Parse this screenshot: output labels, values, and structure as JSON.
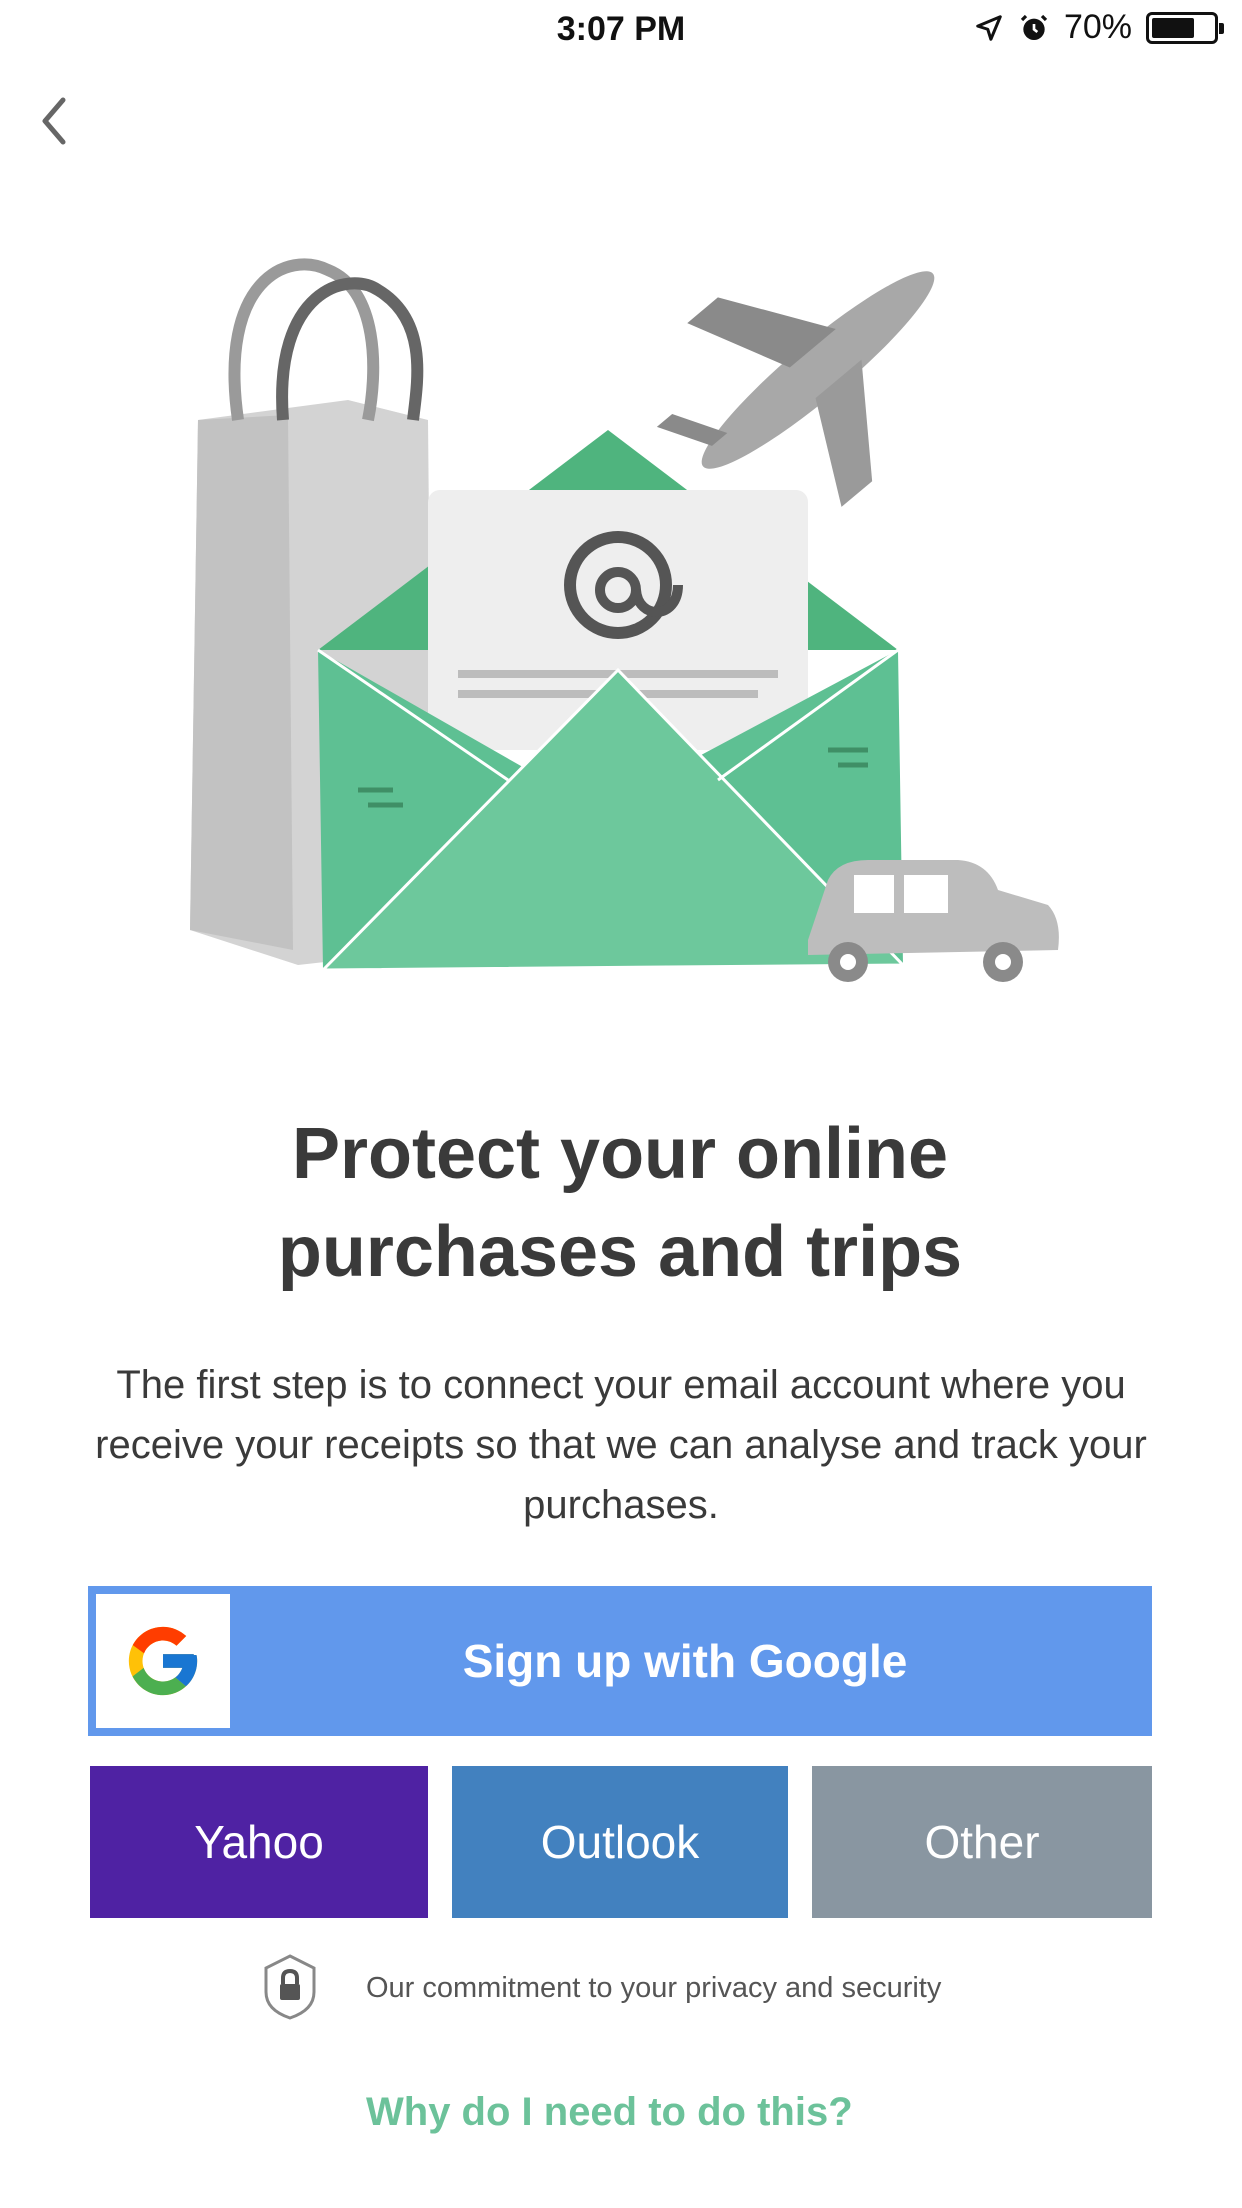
{
  "statusbar": {
    "carrier": "",
    "time": "3:07 PM",
    "battery": "70%",
    "battery_level": 0.7
  },
  "nav": {
    "back_icon": "chevron-left-icon"
  },
  "hero": {
    "illustration": "shopping-bag-envelope-plane-car"
  },
  "content": {
    "title": "Protect your online purchases and trips",
    "description": "The first step is to connect your email account where you receive your receipts so that we can analyse and track your purchases."
  },
  "buttons": {
    "google": "Sign up with Google",
    "yahoo": "Yahoo",
    "outlook": "Outlook",
    "other": "Other"
  },
  "footer": {
    "privacy": "Our commitment to your privacy and security",
    "why": "Why do I need to do this?"
  },
  "colors": {
    "google": "#6198ec",
    "yahoo": "#4f22a3",
    "outlook": "#4281bf",
    "other": "#8996a1",
    "link": "#6cc29a"
  }
}
